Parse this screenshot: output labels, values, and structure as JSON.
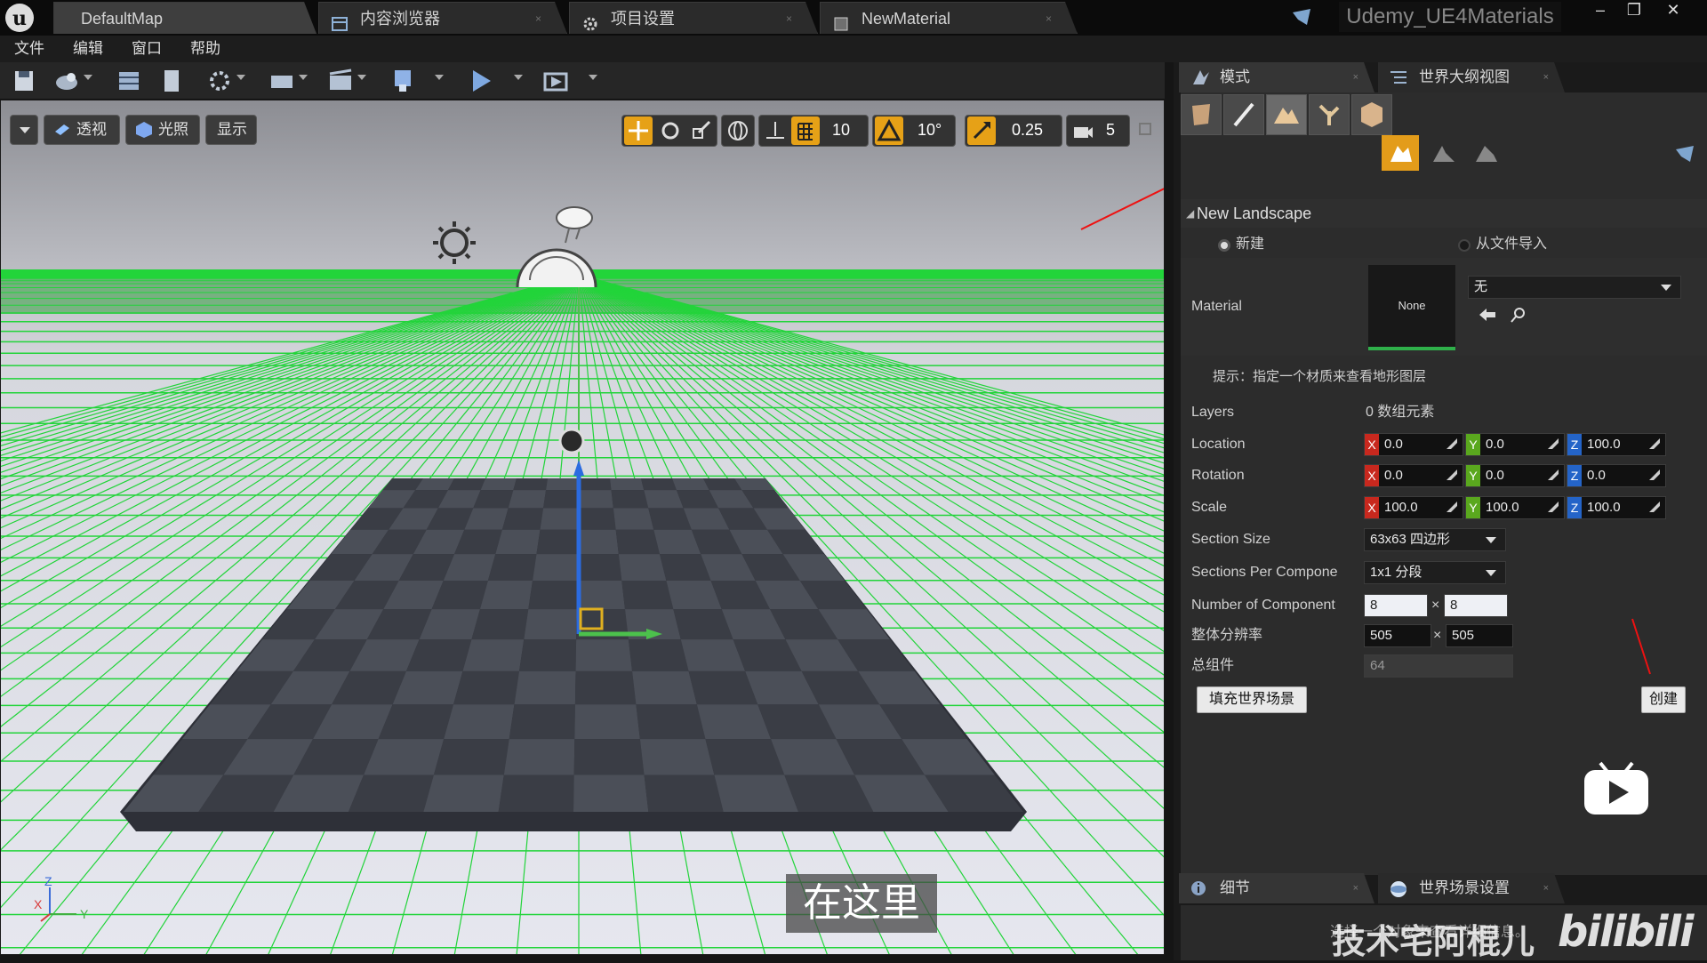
{
  "titlebar": {
    "tabs": [
      {
        "label": "DefaultMap",
        "active": true
      },
      {
        "label": "内容浏览器",
        "active": false
      },
      {
        "label": "项目设置",
        "active": false
      },
      {
        "label": "NewMaterial",
        "active": false
      }
    ],
    "project_name": "Udemy_UE4Materials",
    "close_glyph": "×",
    "window_controls": [
      "‒",
      "❐",
      "✕"
    ]
  },
  "menu": [
    "文件",
    "编辑",
    "窗口",
    "帮助"
  ],
  "viewport": {
    "perspective_label": "透视",
    "lit_label": "光照",
    "show_label": "显示",
    "grid_snap_value": "10",
    "rotation_snap_value": "10°",
    "scale_snap_value": "0.25",
    "camera_speed_value": "5",
    "axis_labels": {
      "z": "Z",
      "x": "X",
      "y": "Y"
    },
    "subtitle": "在这里",
    "colors": {
      "grid": "#22d43a",
      "floor_dark": "#3a3d45",
      "floor_light": "#4b4f58"
    }
  },
  "right_panel": {
    "tabs": [
      {
        "label": "模式"
      },
      {
        "label": "世界大纲视图"
      }
    ],
    "section_title": "New Landscape",
    "new_option": "新建",
    "import_option": "从文件导入",
    "material": {
      "label": "Material",
      "thumb_text": "None",
      "combo_value": "无"
    },
    "hint": "提示：指定一个材质来查看地形图层",
    "layers": {
      "label": "Layers",
      "value": "0 数组元素"
    },
    "location": {
      "label": "Location",
      "x": "0.0",
      "y": "0.0",
      "z": "100.0"
    },
    "rotation": {
      "label": "Rotation",
      "x": "0.0",
      "y": "0.0",
      "z": "0.0"
    },
    "scale": {
      "label": "Scale",
      "x": "100.0",
      "y": "100.0",
      "z": "100.0"
    },
    "section_size": {
      "label": "Section Size",
      "value": "63x63 四边形"
    },
    "sections_per_component": {
      "label": "Sections Per Compone",
      "value": "1x1 分段"
    },
    "num_components": {
      "label": "Number of Component",
      "x": "8",
      "y": "8"
    },
    "overall_resolution": {
      "label": "整体分辨率",
      "x": "505",
      "y": "505"
    },
    "total_components": {
      "label": "总组件",
      "value": "64"
    },
    "fill_world_button": "填充世界场景",
    "create_button": "创建",
    "times_glyph": "×",
    "axis_letters": {
      "x": "X",
      "y": "Y",
      "z": "Z"
    },
    "axis_colors": {
      "x": "#c8281e",
      "y": "#5aa81e",
      "z": "#2464c8"
    }
  },
  "bottom_panel": {
    "tabs": [
      {
        "label": "细节"
      },
      {
        "label": "世界场景设置"
      }
    ],
    "empty_text": "选择一个对象来查看详细信息。"
  },
  "watermark": {
    "author": "技术宅阿棍儿",
    "site": "bilibili"
  }
}
